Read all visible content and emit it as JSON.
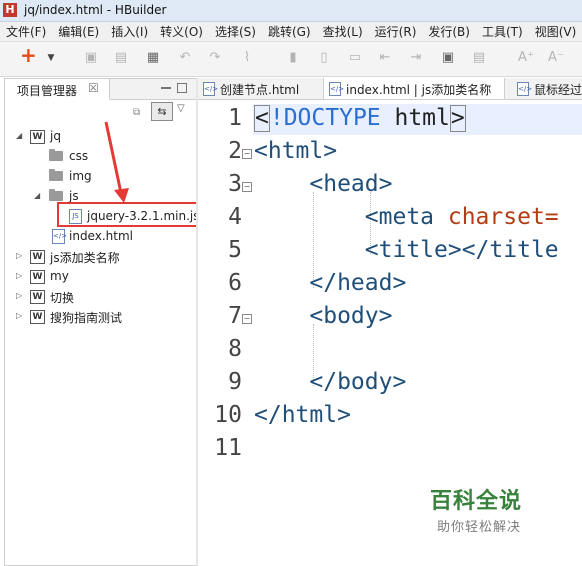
{
  "window": {
    "title": "jq/index.html  -  HBuilder",
    "logo_letter": "H"
  },
  "menu": [
    "文件(F)",
    "编辑(E)",
    "插入(I)",
    "转义(O)",
    "选择(S)",
    "跳转(G)",
    "查找(L)",
    "运行(R)",
    "发行(B)",
    "工具(T)",
    "视图(V)"
  ],
  "left_panel": {
    "title": "项目管理器",
    "close": "☒",
    "tree": [
      {
        "label": "jq",
        "kind": "project",
        "expanded": true
      },
      {
        "label": "css",
        "kind": "folder"
      },
      {
        "label": "img",
        "kind": "folder"
      },
      {
        "label": "js",
        "kind": "folder",
        "expanded": true
      },
      {
        "label": "jquery-3.2.1.min.js",
        "kind": "js-file",
        "highlighted": true
      },
      {
        "label": "index.html",
        "kind": "html-file"
      },
      {
        "label": "js添加类名称",
        "kind": "project",
        "expanded": false
      },
      {
        "label": "my",
        "kind": "project",
        "expanded": false
      },
      {
        "label": "切换",
        "kind": "project",
        "expanded": false
      },
      {
        "label": "搜狗指南测试",
        "kind": "project",
        "expanded": false
      }
    ],
    "highlight_color": "#e53935"
  },
  "editor_tabs": [
    {
      "label": "创建节点.html",
      "active": false
    },
    {
      "label": "index.html | js添加类名称",
      "active": false
    },
    {
      "label": "鼠标经过",
      "active": false
    }
  ],
  "editor": {
    "line_numbers": [
      "1",
      "2",
      "3",
      "4",
      "5",
      "6",
      "7",
      "8",
      "9",
      "10",
      "11"
    ],
    "lines": {
      "l1_open": "<",
      "l1_doctype": "!DOCTYPE",
      "l1_rest": " html",
      "l1_close": ">",
      "l2": "<html>",
      "l3": "    <head>",
      "l4_tag": "        <meta",
      "l4_attr": " charset=",
      "l5": "        <title></title",
      "l6": "    </head>",
      "l7": "    <body>",
      "l8": "",
      "l9": "    </body>",
      "l10": "</html>",
      "l11": ""
    }
  },
  "watermark": {
    "title": "百科全说",
    "subtitle": "助你轻松解决"
  }
}
